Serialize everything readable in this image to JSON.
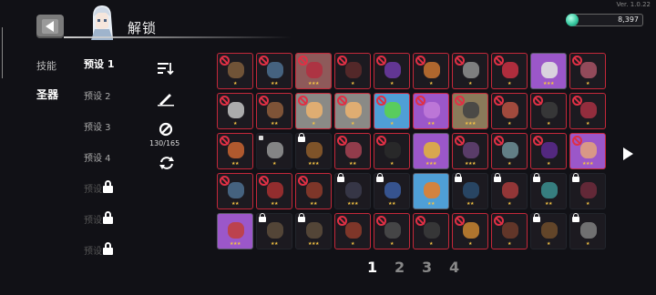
{
  "version": "Ver. 1.0.22",
  "header": {
    "title": "解锁"
  },
  "currency": {
    "value": "8,397",
    "icon": "gem-icon",
    "color": "#36c9a0"
  },
  "categories": [
    {
      "label": "技能",
      "active": false
    },
    {
      "label": "圣器",
      "active": true
    }
  ],
  "presets": [
    {
      "label": "预设 1",
      "state": "active"
    },
    {
      "label": "预设 2",
      "state": "normal"
    },
    {
      "label": "预设 3",
      "state": "normal"
    },
    {
      "label": "预设 4",
      "state": "normal"
    },
    {
      "label": "预设",
      "state": "locked"
    },
    {
      "label": "预设",
      "state": "locked"
    },
    {
      "label": "预设",
      "state": "locked"
    }
  ],
  "tools": {
    "sort_icon": "sort-icon",
    "pen_icon": "pen-icon",
    "ban_icon": "ban-icon",
    "ban_count": "130/165",
    "refresh_icon": "refresh-icon"
  },
  "colors": {
    "ban_border": "#c5283a",
    "star": "#f4c343",
    "rare_bg": "#9b57c9",
    "uncommon_bg": "#4f9fd6",
    "common_bg": "#8a8a86"
  },
  "items": [
    {
      "status": "banned",
      "stars": 1,
      "bg": "dark",
      "icon": "#7a5a3a"
    },
    {
      "status": "banned",
      "stars": 2,
      "bg": "dark",
      "icon": "#4a6a8a"
    },
    {
      "status": "banned",
      "stars": 3,
      "bg": "pink",
      "icon": "#b03040"
    },
    {
      "status": "banned",
      "stars": 1,
      "bg": "dark",
      "icon": "#5a2a2a"
    },
    {
      "status": "banned",
      "stars": 1,
      "bg": "dark",
      "icon": "#6a3aa0"
    },
    {
      "status": "banned",
      "stars": 1,
      "bg": "dark",
      "icon": "#c07030"
    },
    {
      "status": "banned",
      "stars": 1,
      "bg": "dark",
      "icon": "#8a8a8a"
    },
    {
      "status": "banned",
      "stars": 1,
      "bg": "dark",
      "icon": "#c03040"
    },
    {
      "status": "available",
      "stars": 3,
      "bg": "rare",
      "icon": "#e0e0e0"
    },
    {
      "status": "banned",
      "stars": 1,
      "bg": "dark",
      "icon": "#a05060"
    },
    {
      "status": "banned",
      "stars": 1,
      "bg": "dark",
      "icon": "#bbbbbb"
    },
    {
      "status": "banned",
      "stars": 2,
      "bg": "dark",
      "icon": "#8a5a3a"
    },
    {
      "status": "banned",
      "stars": 1,
      "bg": "common",
      "icon": "#e8b070"
    },
    {
      "status": "banned",
      "stars": 1,
      "bg": "common",
      "icon": "#e8b070"
    },
    {
      "status": "banned",
      "stars": 1,
      "bg": "uncommon",
      "icon": "#5ad050"
    },
    {
      "status": "banned",
      "stars": 2,
      "bg": "rare",
      "icon": "#c07ad8"
    },
    {
      "status": "banned",
      "stars": 3,
      "bg": "gold",
      "icon": "#444444"
    },
    {
      "status": "banned",
      "stars": 1,
      "bg": "dark",
      "icon": "#b05040"
    },
    {
      "status": "banned",
      "stars": 1,
      "bg": "dark",
      "icon": "#3a3a3a"
    },
    {
      "status": "banned",
      "stars": 1,
      "bg": "dark",
      "icon": "#a03040"
    },
    {
      "status": "banned",
      "stars": 2,
      "bg": "dark",
      "icon": "#c06030"
    },
    {
      "status": "spot",
      "stars": 1,
      "bg": "dark",
      "icon": "#909090"
    },
    {
      "status": "locked",
      "stars": 3,
      "bg": "dark",
      "icon": "#8a5a2a"
    },
    {
      "status": "banned",
      "stars": 2,
      "bg": "dark",
      "icon": "#a04050"
    },
    {
      "status": "banned",
      "stars": 1,
      "bg": "dark",
      "icon": "#2a2a2a"
    },
    {
      "status": "available",
      "stars": 3,
      "bg": "rare",
      "icon": "#e0b040"
    },
    {
      "status": "banned",
      "stars": 3,
      "bg": "dark",
      "icon": "#604070"
    },
    {
      "status": "banned",
      "stars": 1,
      "bg": "dark",
      "icon": "#6a8a90"
    },
    {
      "status": "banned",
      "stars": 1,
      "bg": "dark",
      "icon": "#5a2a8a"
    },
    {
      "status": "banned",
      "stars": 3,
      "bg": "rare",
      "icon": "#e0a080"
    },
    {
      "status": "banned",
      "stars": 2,
      "bg": "dark",
      "icon": "#4a6a8a"
    },
    {
      "status": "banned",
      "stars": 2,
      "bg": "dark",
      "icon": "#a03030"
    },
    {
      "status": "banned",
      "stars": 2,
      "bg": "dark",
      "icon": "#8a3a2a"
    },
    {
      "status": "locked",
      "stars": 3,
      "bg": "dark",
      "icon": "#3a3a4a"
    },
    {
      "status": "locked",
      "stars": 2,
      "bg": "dark",
      "icon": "#3a5a9a"
    },
    {
      "status": "available",
      "stars": 2,
      "bg": "uncommon",
      "icon": "#e08030"
    },
    {
      "status": "locked",
      "stars": 2,
      "bg": "dark",
      "icon": "#2a4a6a"
    },
    {
      "status": "locked",
      "stars": 1,
      "bg": "dark",
      "icon": "#a03a3a"
    },
    {
      "status": "locked",
      "stars": 2,
      "bg": "dark",
      "icon": "#3a8a8a"
    },
    {
      "status": "locked",
      "stars": 1,
      "bg": "dark",
      "icon": "#6a2a3a"
    },
    {
      "status": "available",
      "stars": 3,
      "bg": "rare",
      "icon": "#c04040"
    },
    {
      "status": "locked",
      "stars": 2,
      "bg": "dark",
      "icon": "#5a4a3a"
    },
    {
      "status": "locked",
      "stars": 3,
      "bg": "dark",
      "icon": "#5a4a3a"
    },
    {
      "status": "banned",
      "stars": 1,
      "bg": "dark",
      "icon": "#8a3a2a"
    },
    {
      "status": "banned",
      "stars": 1,
      "bg": "dark",
      "icon": "#4a4a4a"
    },
    {
      "status": "banned",
      "stars": 1,
      "bg": "dark",
      "icon": "#3a3a3a"
    },
    {
      "status": "banned",
      "stars": 1,
      "bg": "dark",
      "icon": "#c08030"
    },
    {
      "status": "banned",
      "stars": 1,
      "bg": "dark",
      "icon": "#6a3a2a"
    },
    {
      "status": "locked",
      "stars": 1,
      "bg": "dark",
      "icon": "#6a4a2a"
    },
    {
      "status": "locked",
      "stars": 1,
      "bg": "dark",
      "icon": "#7a7a7a"
    }
  ],
  "pagination": {
    "pages": [
      "1",
      "2",
      "3",
      "4"
    ],
    "current": 0
  }
}
